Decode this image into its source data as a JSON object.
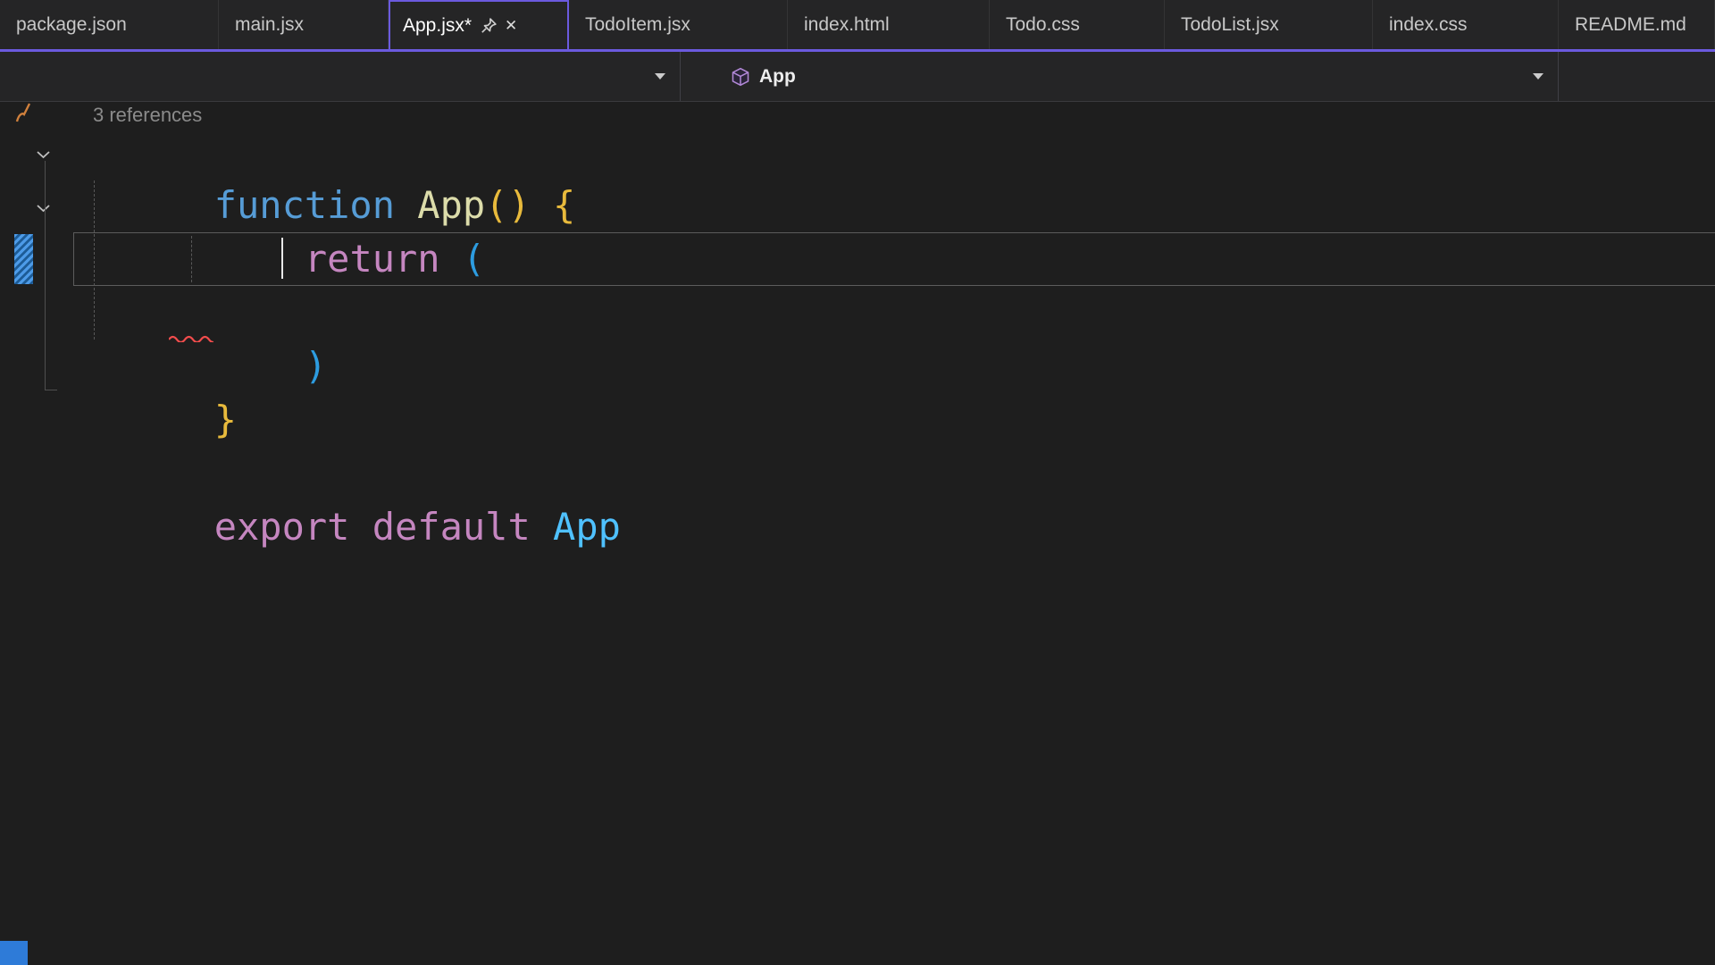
{
  "tabs": [
    {
      "label": "package.json",
      "active": false
    },
    {
      "label": "main.jsx",
      "active": false
    },
    {
      "label": "App.jsx*",
      "active": true,
      "dirty": true
    },
    {
      "label": "TodoItem.jsx",
      "active": false
    },
    {
      "label": "index.html",
      "active": false
    },
    {
      "label": "Todo.css",
      "active": false
    },
    {
      "label": "TodoList.jsx",
      "active": false
    },
    {
      "label": "index.css",
      "active": false
    },
    {
      "label": "README.md",
      "active": false
    }
  ],
  "tab_icons": {
    "pin": "pin-icon",
    "close": "close-icon",
    "close_glyph": "✕"
  },
  "navbar": {
    "scope_label": "App",
    "scope_icon": "cube-icon"
  },
  "editor": {
    "codelens": "3 references",
    "line1": {
      "kw": "function ",
      "name": "App",
      "parens": "()",
      "brace": " {"
    },
    "line2": {
      "indent": "    ",
      "kw": "return ",
      "paren": "("
    },
    "line4": {
      "indent": "    ",
      "paren": ")"
    },
    "line5": {
      "brace": "}"
    },
    "line7": {
      "kw1": "export ",
      "kw2": "default ",
      "name": "App"
    }
  },
  "colors": {
    "accent_purple": "#6B5ADE",
    "editor_bg": "#1E1E1E",
    "tabbar_bg": "#252526",
    "keyword_blue": "#569CD6",
    "keyword_pink": "#C586C0",
    "function_yellow": "#DCDCAA",
    "bracket_gold": "#E8BA3C",
    "paren_blue": "#2D9CE0",
    "identifier_blue": "#4FC1FF",
    "error_squiggle_red": "#F14C4C",
    "change_margin_blue": "#4D9BE8",
    "status_corner_blue": "#2E7BD8"
  }
}
